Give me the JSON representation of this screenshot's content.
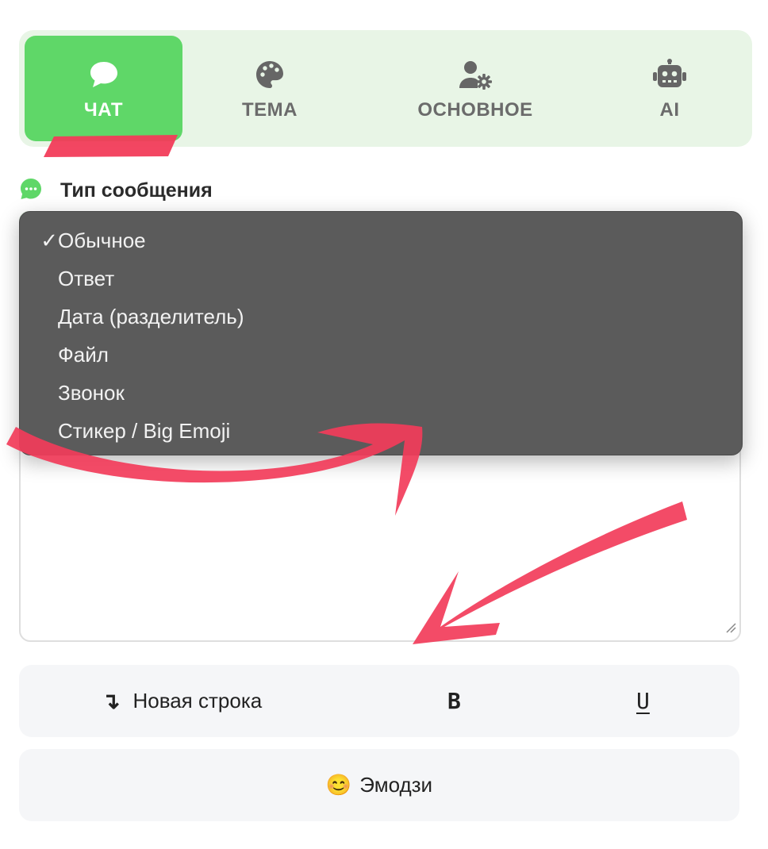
{
  "tabs": [
    {
      "label": "ЧАТ",
      "icon": "chat-bubble-icon",
      "active": true
    },
    {
      "label": "ТЕМА",
      "icon": "palette-icon",
      "active": false
    },
    {
      "label": "ОСНОВНОЕ",
      "icon": "user-gear-icon",
      "active": false
    },
    {
      "label": "AI",
      "icon": "robot-icon",
      "active": false
    }
  ],
  "section": {
    "title": "Тип сообщения",
    "icon": "whatsapp-chat-icon"
  },
  "dropdown": {
    "check_mark": "✓",
    "selected_index": 0,
    "options": [
      "Обычное",
      "Ответ",
      "Дата (разделитель)",
      "Файл",
      "Звонок",
      "Стикер / Big Emoji"
    ]
  },
  "toolbar": {
    "newline_icon": "↴",
    "newline_label": "Новая строка",
    "bold_label": "B",
    "underline_label": "U"
  },
  "emoji_button": {
    "emoji": "😊",
    "label": "Эмодзи"
  },
  "colors": {
    "accent_green": "#5fd768",
    "tab_bar_bg": "#e8f5e6",
    "dropdown_bg": "#5b5b5b",
    "annotation_red": "#f23c5a"
  }
}
